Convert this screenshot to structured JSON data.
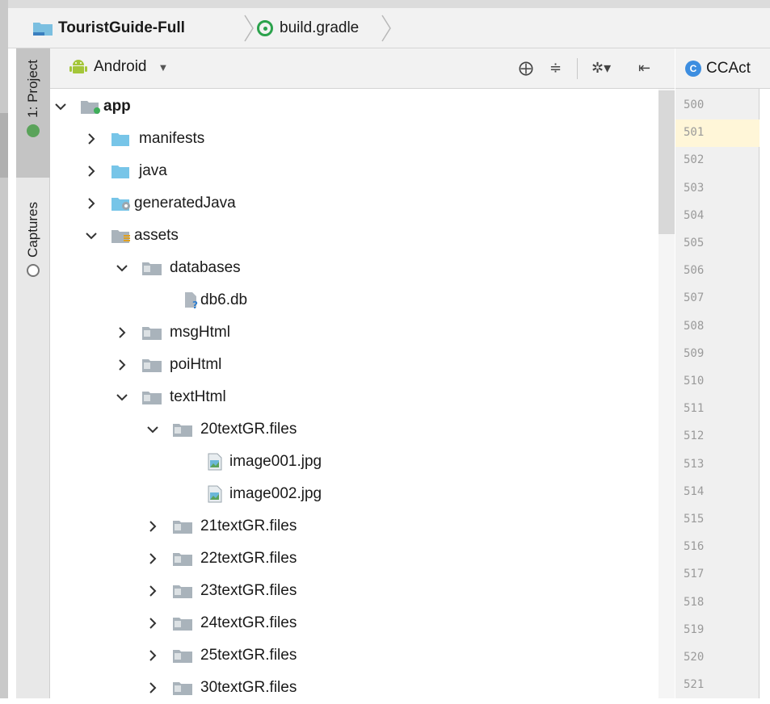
{
  "breadcrumb": {
    "project": "TouristGuide-Full",
    "file": "build.gradle"
  },
  "tool_strip": {
    "project_tab": "1: Project",
    "captures_tab": "Captures"
  },
  "panel": {
    "view_selector": "Android"
  },
  "tree": [
    {
      "label": "app",
      "depth": 0,
      "expanded": true,
      "icon": "module-folder-icon",
      "bold": true
    },
    {
      "label": "manifests",
      "depth": 1,
      "expanded": false,
      "icon": "folder-icon"
    },
    {
      "label": "java",
      "depth": 1,
      "expanded": false,
      "icon": "folder-icon"
    },
    {
      "label": "generatedJava",
      "depth": 1,
      "expanded": false,
      "icon": "generated-folder-icon"
    },
    {
      "label": "assets",
      "depth": 1,
      "expanded": true,
      "icon": "assets-folder-icon"
    },
    {
      "label": "databases",
      "depth": 2,
      "expanded": true,
      "icon": "grey-folder-icon"
    },
    {
      "label": "db6.db",
      "depth": 3,
      "leaf": true,
      "icon": "unknown-file-icon"
    },
    {
      "label": "msgHtml",
      "depth": 2,
      "expanded": false,
      "icon": "grey-folder-icon"
    },
    {
      "label": "poiHtml",
      "depth": 2,
      "expanded": false,
      "icon": "grey-folder-icon"
    },
    {
      "label": "textHtml",
      "depth": 2,
      "expanded": true,
      "icon": "grey-folder-icon"
    },
    {
      "label": "20textGR.files",
      "depth": 3,
      "expanded": true,
      "icon": "grey-folder-icon"
    },
    {
      "label": "image001.jpg",
      "depth": 4,
      "leaf": true,
      "icon": "image-file-icon"
    },
    {
      "label": "image002.jpg",
      "depth": 4,
      "leaf": true,
      "icon": "image-file-icon"
    },
    {
      "label": "21textGR.files",
      "depth": 3,
      "expanded": false,
      "icon": "grey-folder-icon"
    },
    {
      "label": "22textGR.files",
      "depth": 3,
      "expanded": false,
      "icon": "grey-folder-icon"
    },
    {
      "label": "23textGR.files",
      "depth": 3,
      "expanded": false,
      "icon": "grey-folder-icon"
    },
    {
      "label": "24textGR.files",
      "depth": 3,
      "expanded": false,
      "icon": "grey-folder-icon"
    },
    {
      "label": "25textGR.files",
      "depth": 3,
      "expanded": false,
      "icon": "grey-folder-icon"
    },
    {
      "label": "30textGR.files",
      "depth": 3,
      "expanded": false,
      "icon": "grey-folder-icon"
    }
  ],
  "editor": {
    "tab_badge": "C",
    "tab_title": "CCAct",
    "line_numbers": [
      "500",
      "501",
      "502",
      "503",
      "504",
      "505",
      "506",
      "507",
      "508",
      "509",
      "510",
      "511",
      "512",
      "513",
      "514",
      "515",
      "516",
      "517",
      "518",
      "519",
      "520",
      "521"
    ],
    "current_line": "501"
  },
  "colors": {
    "folder_blue": "#77c5e8",
    "folder_grey": "#a9b3bb",
    "android_green": "#a4c639",
    "current_line_bg": "#fff6d8"
  }
}
